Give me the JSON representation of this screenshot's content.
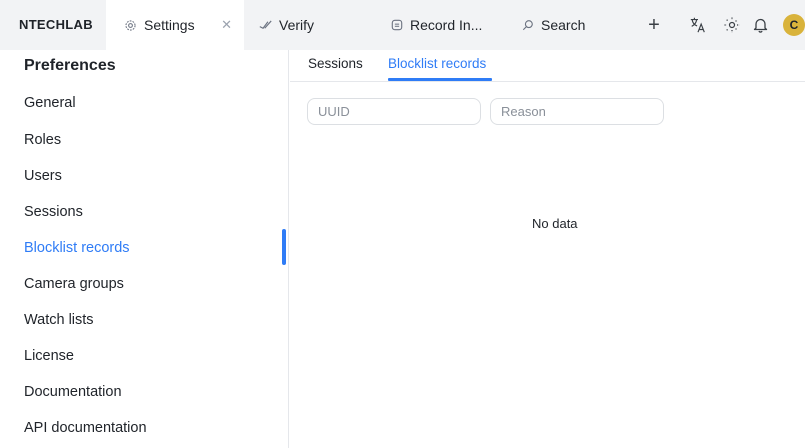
{
  "header": {
    "brand": "NTECHLAB",
    "tabs": [
      {
        "label": "Settings",
        "icon": "gear-icon",
        "closable": true
      },
      {
        "label": "Verify",
        "icon": "verify-icon"
      },
      {
        "label": "Record In...",
        "icon": "record-icon"
      },
      {
        "label": "Search",
        "icon": "search-icon"
      }
    ],
    "add_icon": "+",
    "avatar_letter": "C"
  },
  "sidebar": {
    "title": "Preferences",
    "items": [
      {
        "label": "General"
      },
      {
        "label": "Roles"
      },
      {
        "label": "Users"
      },
      {
        "label": "Sessions"
      },
      {
        "label": "Blocklist records",
        "active": true
      },
      {
        "label": "Camera groups"
      },
      {
        "label": "Watch lists"
      },
      {
        "label": "License"
      },
      {
        "label": "Documentation"
      },
      {
        "label": "API documentation"
      }
    ]
  },
  "main": {
    "subtabs": [
      {
        "label": "Sessions"
      },
      {
        "label": "Blocklist records",
        "active": true
      }
    ],
    "filters": {
      "uuid_placeholder": "UUID",
      "reason_placeholder": "Reason"
    },
    "empty_text": "No data"
  },
  "colors": {
    "accent": "#2f7cf6",
    "avatar": "#d9b33b",
    "topbar": "#f2f3f5"
  }
}
